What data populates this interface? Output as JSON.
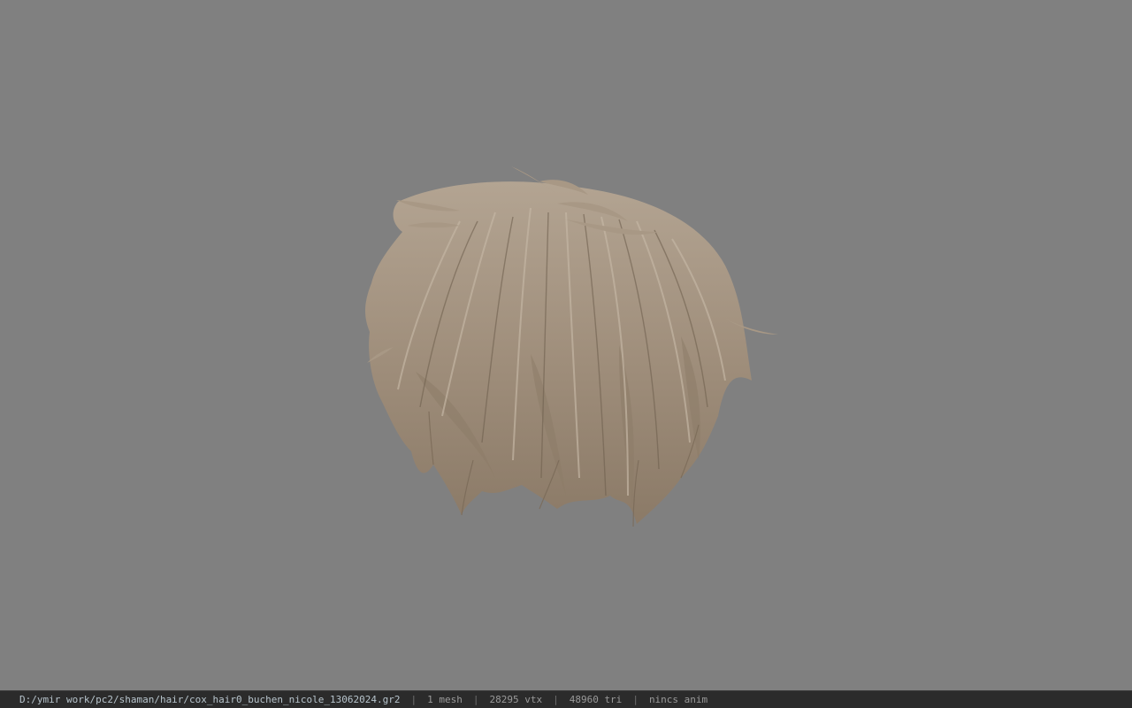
{
  "viewport": {
    "background_color": "#808080",
    "model": {
      "icon": "hair-mesh-model",
      "hair_color": "#a59684"
    }
  },
  "status_bar": {
    "file_path": "D:/ymir work/pc2/shaman/hair/cox_hair0_buchen_nicole_13062024.gr2",
    "separator": "|",
    "mesh_count": "1 mesh",
    "vertex_count": "28295 vtx",
    "triangle_count": "48960 tri",
    "anim_status": "nincs anim"
  }
}
